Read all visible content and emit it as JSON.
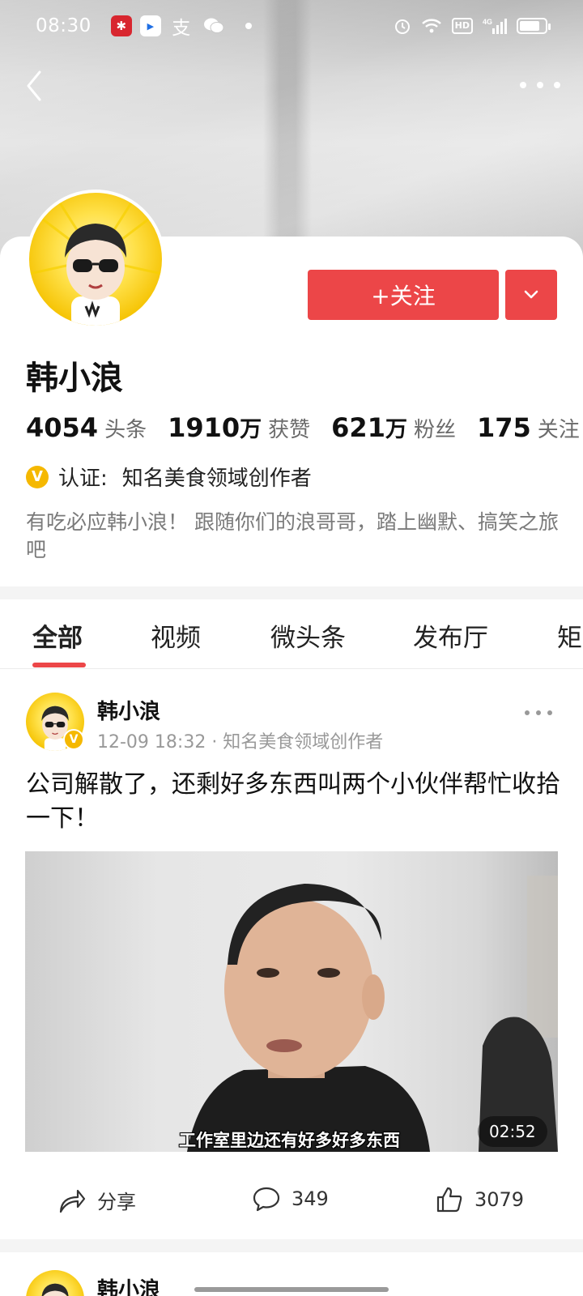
{
  "status_bar": {
    "time": "08:30",
    "app_icons": [
      "pinduoduo-icon",
      "youku-icon",
      "alipay-icon",
      "wechat-icon"
    ],
    "alipay_glyph": "支",
    "network_label": "4G",
    "hd_label": "HD"
  },
  "header": {
    "back_icon": "chevron-left-icon",
    "more_icon": "more-dots-icon"
  },
  "profile": {
    "name": "韩小浪",
    "follow_label": "+关注",
    "stats": [
      {
        "num": "4054",
        "unit": "",
        "label": "头条"
      },
      {
        "num": "1910",
        "unit": "万",
        "label": "获赞"
      },
      {
        "num": "621",
        "unit": "万",
        "label": "粉丝"
      },
      {
        "num": "175",
        "unit": "",
        "label": "关注"
      }
    ],
    "verify_badge": "V",
    "verify_label": "认证:",
    "verify_text": "知名美食领域创作者",
    "bio": "有吃必应韩小浪！ 跟随你们的浪哥哥，踏上幽默、搞笑之旅吧"
  },
  "tabs": [
    {
      "label": "全部",
      "active": true
    },
    {
      "label": "视频",
      "active": false
    },
    {
      "label": "微头条",
      "active": false
    },
    {
      "label": "发布厅",
      "active": false
    },
    {
      "label": "矩",
      "active": false
    }
  ],
  "post": {
    "author": "韩小浪",
    "badge": "V",
    "meta": "12-09 18:32 · 知名美食领域创作者",
    "text": "公司解散了，还剩好多东西叫两个小伙伴帮忙收拾一下！",
    "video_caption": "工作室里边还有好多好多东西",
    "video_duration": "02:52",
    "share_label": "分享",
    "comment_count": "349",
    "like_count": "3079"
  },
  "next_post": {
    "author": "韩小浪"
  },
  "colors": {
    "accent": "#ec4648",
    "verify": "#f5b800",
    "muted_text": "#7a7a7a"
  }
}
